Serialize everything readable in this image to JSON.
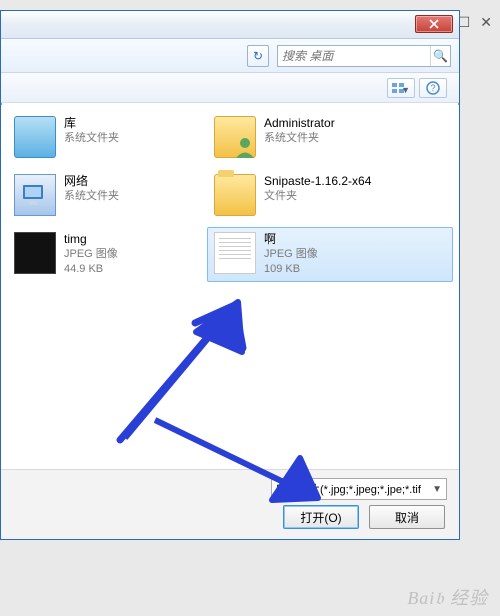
{
  "search": {
    "placeholder": "搜索 桌面"
  },
  "left_items": [
    {
      "name": "库",
      "sub1": "系统文件夹",
      "sub2": "",
      "thumb": "lib"
    },
    {
      "name": "网络",
      "sub1": "系统文件夹",
      "sub2": "",
      "thumb": "net"
    },
    {
      "name": "timg",
      "sub1": "JPEG 图像",
      "sub2": "44.9 KB",
      "thumb": "dark"
    }
  ],
  "right_items": [
    {
      "name": "Administrator",
      "sub1": "系统文件夹",
      "sub2": "",
      "thumb": "user",
      "selected": false
    },
    {
      "name": "Snipaste-1.16.2-x64",
      "sub1": "文件夹",
      "sub2": "",
      "thumb": "folder",
      "selected": false
    },
    {
      "name": "啊",
      "sub1": "JPEG 图像",
      "sub2": "109 KB",
      "thumb": "doc",
      "selected": true
    }
  ],
  "filter": {
    "label": "所有图片(*.jpg;*.jpeg;*.jpe;*.tif"
  },
  "buttons": {
    "open": "打开(O)",
    "cancel": "取消"
  }
}
